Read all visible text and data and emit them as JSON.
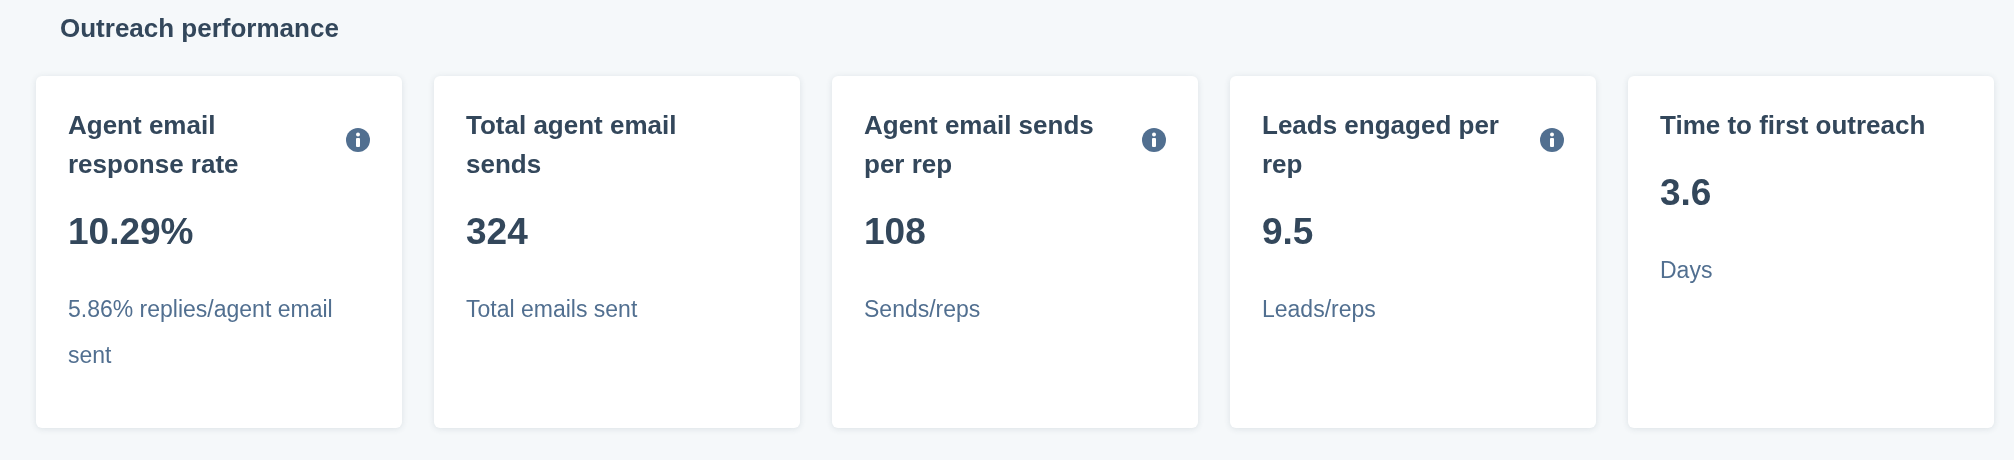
{
  "section_title": "Outreach performance",
  "cards": [
    {
      "title": "Agent email response rate",
      "info": true,
      "value": "10.29%",
      "caption": "5.86% replies/agent email sent"
    },
    {
      "title": "Total agent email sends",
      "info": false,
      "value": "324",
      "caption": "Total emails sent"
    },
    {
      "title": "Agent email sends per rep",
      "info": true,
      "value": "108",
      "caption": "Sends/reps"
    },
    {
      "title": "Leads engaged per rep",
      "info": true,
      "value": "9.5",
      "caption": "Leads/reps"
    },
    {
      "title": "Time to first outreach",
      "info": false,
      "value": "3.6",
      "caption": "Days"
    }
  ]
}
